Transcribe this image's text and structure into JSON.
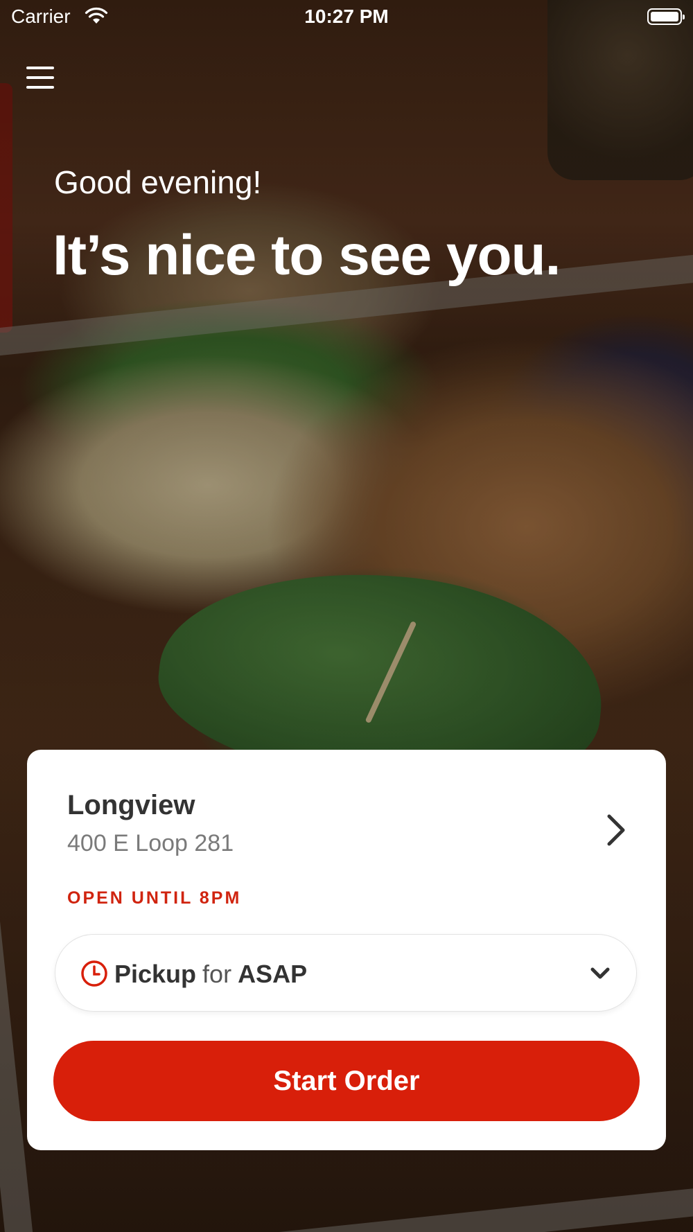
{
  "status_bar": {
    "carrier": "Carrier",
    "time": "10:27 PM",
    "icons": [
      "wifi-icon",
      "battery-icon"
    ]
  },
  "header": {
    "menu_icon": "hamburger-menu-icon"
  },
  "hero": {
    "greeting": "Good evening!",
    "headline": "It’s nice to see you."
  },
  "location_card": {
    "name": "Longview",
    "address": "400 E Loop 281",
    "hours": "OPEN UNTIL 8PM",
    "chevron_icon": "chevron-right-icon"
  },
  "order_mode": {
    "clock_icon": "clock-icon",
    "mode": "Pickup",
    "connector": "for",
    "time": "ASAP",
    "dropdown_icon": "chevron-down-icon"
  },
  "start_button": {
    "label": "Start Order"
  },
  "colors": {
    "brand_red": "#d81f0a",
    "hours_red": "#d0240f",
    "text_dark": "#333333",
    "text_gray": "#7a7a7a",
    "card_bg": "#ffffff"
  }
}
